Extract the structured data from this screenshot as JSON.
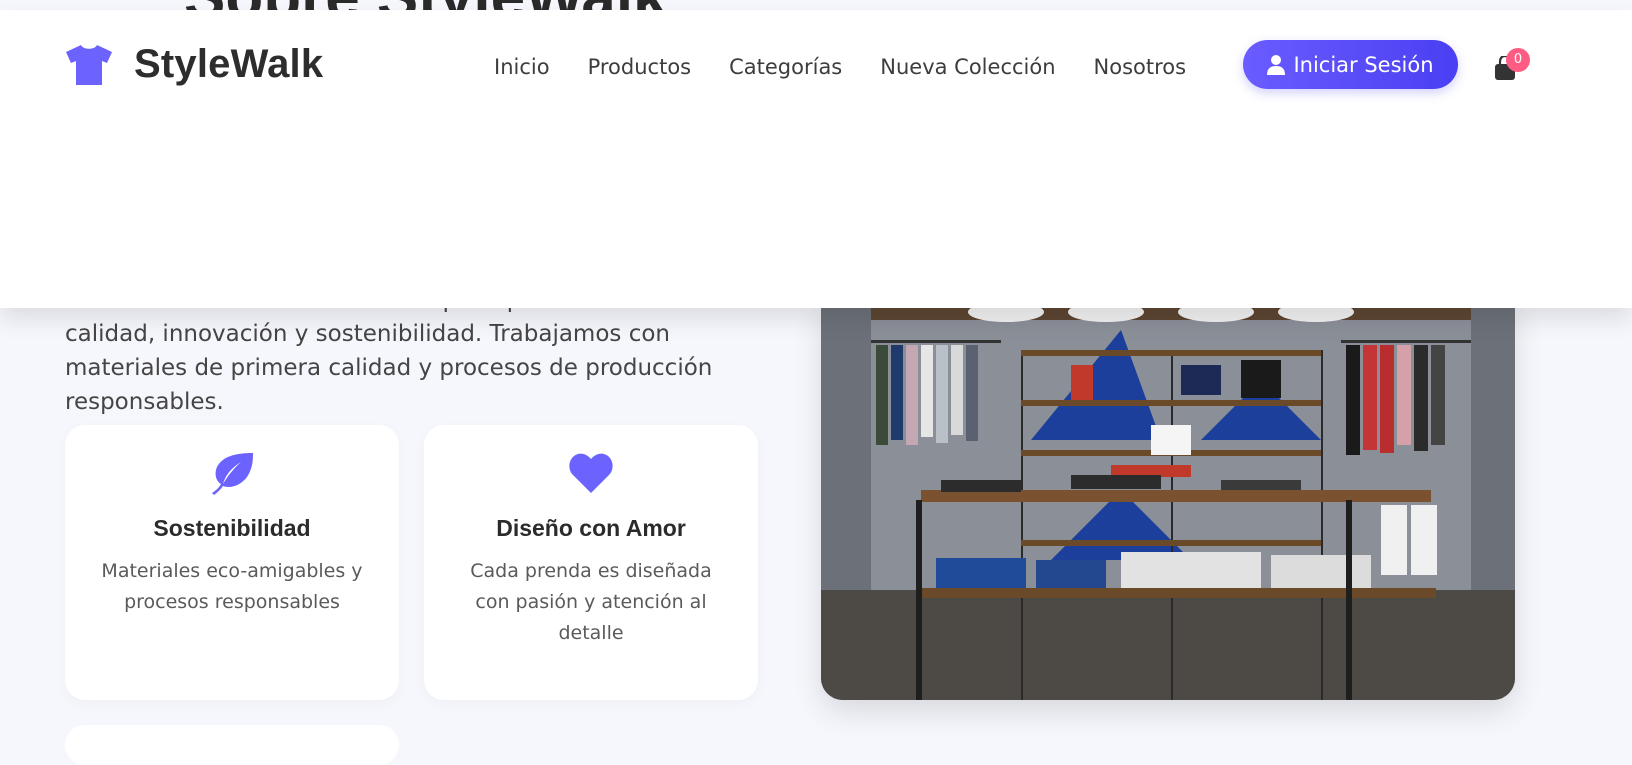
{
  "hero": {
    "title": "Sobre StyleWalk"
  },
  "header": {
    "brand": "StyleWalk",
    "nav": [
      "Inicio",
      "Productos",
      "Categorías",
      "Nueva Colección",
      "Nosotros"
    ],
    "login_label": "Iniciar Sesión",
    "cart_count": "0"
  },
  "about": {
    "description": "Nuestra filosofía se basa en tres principios fundamentales: calidad, innovación y sostenibilidad. Trabajamos con materiales de primera calidad y procesos de producción responsables.",
    "features": [
      {
        "icon": "leaf-icon",
        "title": "Sostenibilidad",
        "text": "Materiales eco-amigables y procesos responsables"
      },
      {
        "icon": "heart-icon",
        "title": "Diseño con Amor",
        "text": "Cada prenda es diseñada con pasión y atención al detalle"
      }
    ]
  },
  "colors": {
    "accent": "#6c63ff",
    "badge": "#ff5c84",
    "background": "#f6f7fc"
  }
}
